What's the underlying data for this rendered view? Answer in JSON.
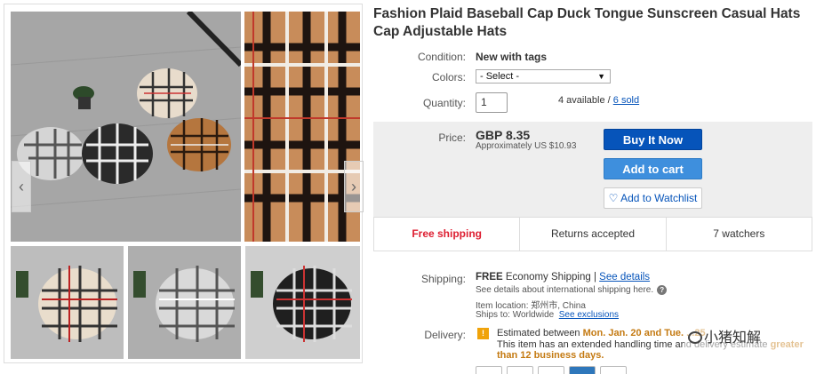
{
  "gallery": {
    "prev_arrow": "‹",
    "next_arrow": "›"
  },
  "listing": {
    "title": "Fashion Plaid Baseball Cap Duck Tongue Sunscreen Casual Hats Cap Adjustable Hats",
    "condition_label": "Condition:",
    "condition_value": "New with tags",
    "colors_label": "Colors:",
    "colors_selected": "- Select -",
    "quantity_label": "Quantity:",
    "quantity_value": "1",
    "available_text": "4 available / ",
    "sold_link": "6 sold"
  },
  "purchase": {
    "price_label": "Price:",
    "price": "GBP 8.35",
    "approx_price": "Approximately US $10.93",
    "buy_now": "Buy It Now",
    "add_to_cart": "Add to cart",
    "add_to_watchlist": "Add to Watchlist"
  },
  "info_bar": {
    "shipping": "Free shipping",
    "returns": "Returns accepted",
    "watchers": "7 watchers"
  },
  "shipping": {
    "label": "Shipping:",
    "free": "FREE",
    "service": "Economy Shipping |",
    "see_details": "See details",
    "international": "See details about international shipping here.",
    "item_location": "Item location:  郑州市, China",
    "ships_to": "Ships to:  Worldwide",
    "see_exclusions": "See exclusions"
  },
  "delivery": {
    "label": "Delivery:",
    "icon": "!",
    "estimated_prefix": "Estimated between ",
    "estimated_dates": "Mon. Jan. 20 and Tue. ...25",
    "handling_text": "This item has an extended handling time and delivery estimate ",
    "handling_highlight": "greater",
    "handling_end": "than 12 business days."
  },
  "watermark": {
    "text": "小猪知解"
  },
  "colors": {
    "link": "#0654ba",
    "buy_button": "#0654ba",
    "cart_button": "#3e8fdd",
    "free_shipping": "#dd1e31",
    "delivery_highlight": "#c47a12"
  }
}
